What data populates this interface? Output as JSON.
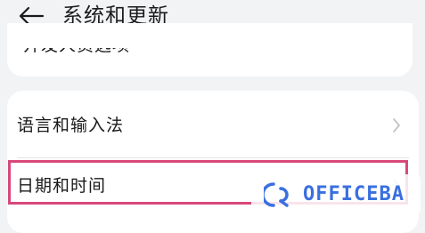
{
  "header": {
    "back_icon": "arrow-left-icon",
    "title": "系统和更新"
  },
  "top_card": {
    "partial_label": "开发人员选项"
  },
  "settings": {
    "items": [
      {
        "label": "语言和输入法",
        "icon": "chevron-right-icon"
      },
      {
        "label": "日期和时间",
        "icon": "chevron-right-icon"
      }
    ]
  },
  "highlight": {
    "color": "#d7497a"
  },
  "watermark": {
    "text": "OFFICEBA",
    "color": "#3a6fe0"
  }
}
